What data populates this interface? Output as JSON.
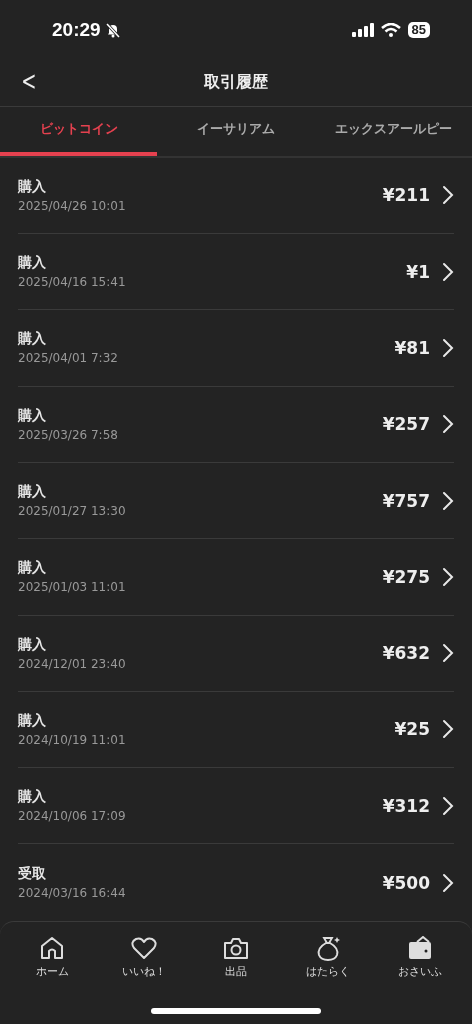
{
  "status_bar": {
    "time": "20:29",
    "silent": true,
    "battery": "85"
  },
  "header": {
    "back": "<",
    "title": "取引履歴"
  },
  "tabs": [
    {
      "label": "ビットコイン",
      "selected": true
    },
    {
      "label": "イーサリアム",
      "selected": false
    },
    {
      "label": "エックスアールピー",
      "selected": false
    }
  ],
  "transactions": [
    {
      "type": "購入",
      "date": "2025/04/26 10:01",
      "amount": "¥211"
    },
    {
      "type": "購入",
      "date": "2025/04/16 15:41",
      "amount": "¥1"
    },
    {
      "type": "購入",
      "date": "2025/04/01 7:32",
      "amount": "¥81"
    },
    {
      "type": "購入",
      "date": "2025/03/26 7:58",
      "amount": "¥257"
    },
    {
      "type": "購入",
      "date": "2025/01/27 13:30",
      "amount": "¥757"
    },
    {
      "type": "購入",
      "date": "2025/01/03 11:01",
      "amount": "¥275"
    },
    {
      "type": "購入",
      "date": "2024/12/01 23:40",
      "amount": "¥632"
    },
    {
      "type": "購入",
      "date": "2024/10/19 11:01",
      "amount": "¥25"
    },
    {
      "type": "購入",
      "date": "2024/10/06 17:09",
      "amount": "¥312"
    },
    {
      "type": "受取",
      "date": "2024/03/16 16:44",
      "amount": "¥500"
    }
  ],
  "bottom_nav": [
    {
      "kind": "home",
      "label": "ホーム"
    },
    {
      "kind": "heart",
      "label": "いいね！"
    },
    {
      "kind": "camera",
      "label": "出品"
    },
    {
      "kind": "bag",
      "label": "はたらく"
    },
    {
      "kind": "wallet",
      "label": "おさいふ"
    }
  ]
}
